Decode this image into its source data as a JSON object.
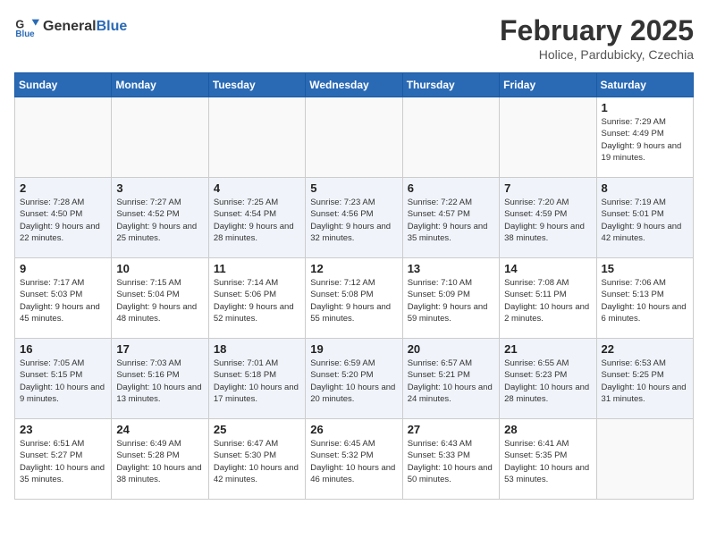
{
  "header": {
    "logo_general": "General",
    "logo_blue": "Blue",
    "month_year": "February 2025",
    "location": "Holice, Pardubicky, Czechia"
  },
  "days_of_week": [
    "Sunday",
    "Monday",
    "Tuesday",
    "Wednesday",
    "Thursday",
    "Friday",
    "Saturday"
  ],
  "weeks": [
    [
      {
        "day": "",
        "info": ""
      },
      {
        "day": "",
        "info": ""
      },
      {
        "day": "",
        "info": ""
      },
      {
        "day": "",
        "info": ""
      },
      {
        "day": "",
        "info": ""
      },
      {
        "day": "",
        "info": ""
      },
      {
        "day": "1",
        "info": "Sunrise: 7:29 AM\nSunset: 4:49 PM\nDaylight: 9 hours and 19 minutes."
      }
    ],
    [
      {
        "day": "2",
        "info": "Sunrise: 7:28 AM\nSunset: 4:50 PM\nDaylight: 9 hours and 22 minutes."
      },
      {
        "day": "3",
        "info": "Sunrise: 7:27 AM\nSunset: 4:52 PM\nDaylight: 9 hours and 25 minutes."
      },
      {
        "day": "4",
        "info": "Sunrise: 7:25 AM\nSunset: 4:54 PM\nDaylight: 9 hours and 28 minutes."
      },
      {
        "day": "5",
        "info": "Sunrise: 7:23 AM\nSunset: 4:56 PM\nDaylight: 9 hours and 32 minutes."
      },
      {
        "day": "6",
        "info": "Sunrise: 7:22 AM\nSunset: 4:57 PM\nDaylight: 9 hours and 35 minutes."
      },
      {
        "day": "7",
        "info": "Sunrise: 7:20 AM\nSunset: 4:59 PM\nDaylight: 9 hours and 38 minutes."
      },
      {
        "day": "8",
        "info": "Sunrise: 7:19 AM\nSunset: 5:01 PM\nDaylight: 9 hours and 42 minutes."
      }
    ],
    [
      {
        "day": "9",
        "info": "Sunrise: 7:17 AM\nSunset: 5:03 PM\nDaylight: 9 hours and 45 minutes."
      },
      {
        "day": "10",
        "info": "Sunrise: 7:15 AM\nSunset: 5:04 PM\nDaylight: 9 hours and 48 minutes."
      },
      {
        "day": "11",
        "info": "Sunrise: 7:14 AM\nSunset: 5:06 PM\nDaylight: 9 hours and 52 minutes."
      },
      {
        "day": "12",
        "info": "Sunrise: 7:12 AM\nSunset: 5:08 PM\nDaylight: 9 hours and 55 minutes."
      },
      {
        "day": "13",
        "info": "Sunrise: 7:10 AM\nSunset: 5:09 PM\nDaylight: 9 hours and 59 minutes."
      },
      {
        "day": "14",
        "info": "Sunrise: 7:08 AM\nSunset: 5:11 PM\nDaylight: 10 hours and 2 minutes."
      },
      {
        "day": "15",
        "info": "Sunrise: 7:06 AM\nSunset: 5:13 PM\nDaylight: 10 hours and 6 minutes."
      }
    ],
    [
      {
        "day": "16",
        "info": "Sunrise: 7:05 AM\nSunset: 5:15 PM\nDaylight: 10 hours and 9 minutes."
      },
      {
        "day": "17",
        "info": "Sunrise: 7:03 AM\nSunset: 5:16 PM\nDaylight: 10 hours and 13 minutes."
      },
      {
        "day": "18",
        "info": "Sunrise: 7:01 AM\nSunset: 5:18 PM\nDaylight: 10 hours and 17 minutes."
      },
      {
        "day": "19",
        "info": "Sunrise: 6:59 AM\nSunset: 5:20 PM\nDaylight: 10 hours and 20 minutes."
      },
      {
        "day": "20",
        "info": "Sunrise: 6:57 AM\nSunset: 5:21 PM\nDaylight: 10 hours and 24 minutes."
      },
      {
        "day": "21",
        "info": "Sunrise: 6:55 AM\nSunset: 5:23 PM\nDaylight: 10 hours and 28 minutes."
      },
      {
        "day": "22",
        "info": "Sunrise: 6:53 AM\nSunset: 5:25 PM\nDaylight: 10 hours and 31 minutes."
      }
    ],
    [
      {
        "day": "23",
        "info": "Sunrise: 6:51 AM\nSunset: 5:27 PM\nDaylight: 10 hours and 35 minutes."
      },
      {
        "day": "24",
        "info": "Sunrise: 6:49 AM\nSunset: 5:28 PM\nDaylight: 10 hours and 38 minutes."
      },
      {
        "day": "25",
        "info": "Sunrise: 6:47 AM\nSunset: 5:30 PM\nDaylight: 10 hours and 42 minutes."
      },
      {
        "day": "26",
        "info": "Sunrise: 6:45 AM\nSunset: 5:32 PM\nDaylight: 10 hours and 46 minutes."
      },
      {
        "day": "27",
        "info": "Sunrise: 6:43 AM\nSunset: 5:33 PM\nDaylight: 10 hours and 50 minutes."
      },
      {
        "day": "28",
        "info": "Sunrise: 6:41 AM\nSunset: 5:35 PM\nDaylight: 10 hours and 53 minutes."
      },
      {
        "day": "",
        "info": ""
      }
    ]
  ]
}
